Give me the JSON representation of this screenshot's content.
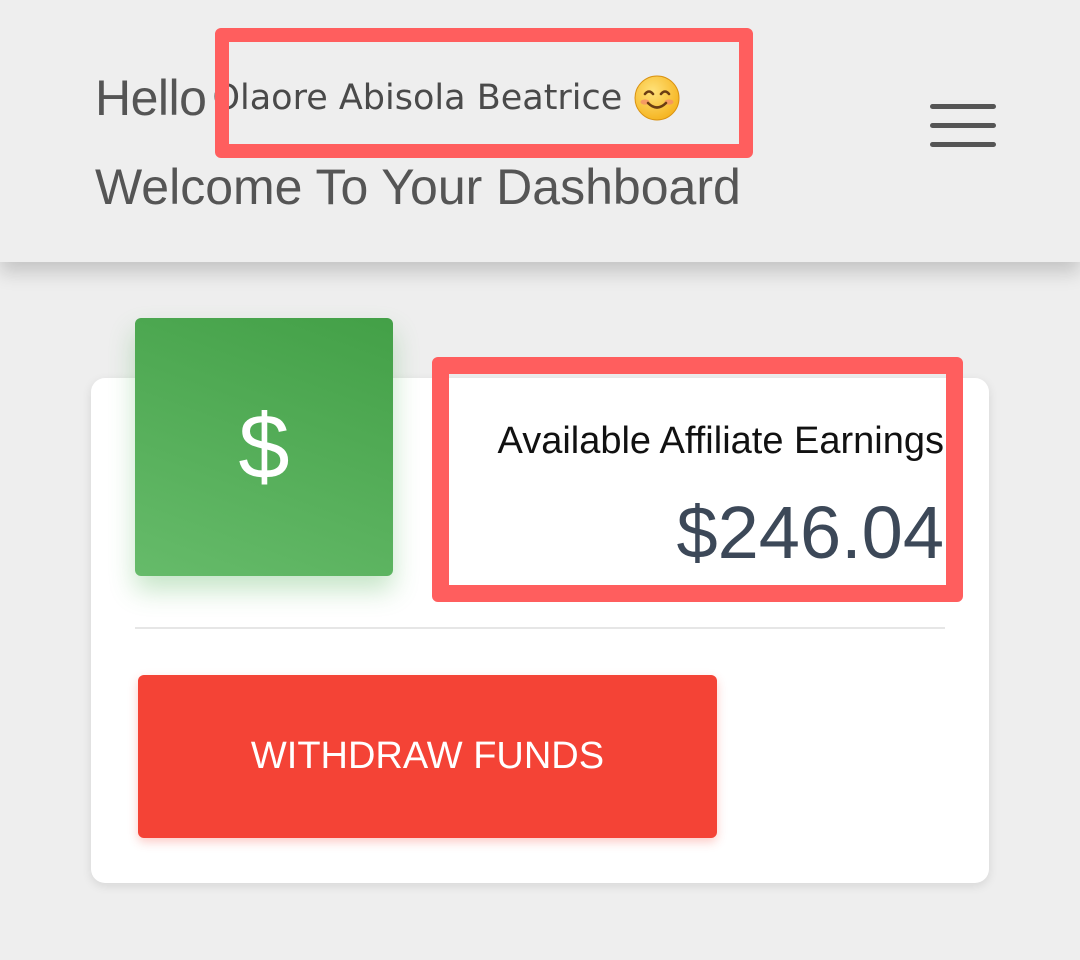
{
  "header": {
    "greeting": "Hello",
    "user_name": "Olaore Abisola Beatrice",
    "emoji": "smiling-face-emoji",
    "subtitle": "Welcome To Your Dashboard",
    "menu_icon": "hamburger-menu-icon"
  },
  "earnings_card": {
    "icon": "dollar-icon",
    "icon_glyph": "$",
    "label": "Available Affiliate Earnings",
    "amount": "$246.04",
    "withdraw_label": "WITHDRAW FUNDS"
  },
  "colors": {
    "highlight": "#ff5e5e",
    "icon_green": "#4caf50",
    "button_red": "#f44336",
    "amount_text": "#3c4858"
  }
}
